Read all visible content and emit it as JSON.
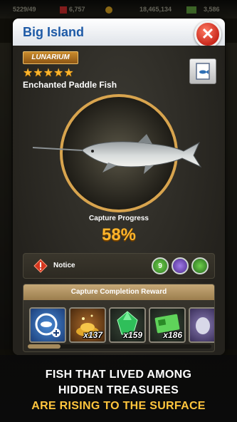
{
  "hud": {
    "stat1": "5229/49",
    "stat2": "6,757",
    "stat3": "18,465,134",
    "stat4": "3,586"
  },
  "panel": {
    "title": "Big Island",
    "close_icon": "close-x-icon",
    "rarity": "LUNARIUM",
    "stars": "★★★★★",
    "star_count": 5,
    "fish_name": "Enchanted Paddle Fish",
    "capture_label": "Capture Progress",
    "capture_value": "58%",
    "notice_label": "Notice",
    "baits": [
      {
        "label": "9",
        "color": "#4fa33a"
      },
      {
        "label": "",
        "color": "#7a4bc6"
      },
      {
        "label": "",
        "color": "#3f9c3a"
      }
    ],
    "reward_title": "Capture Completion Reward",
    "rewards": [
      {
        "icon": "fish-slot-plus-icon",
        "count": ""
      },
      {
        "icon": "gold-coin-pile-icon",
        "count": "x137"
      },
      {
        "icon": "green-gem-icon",
        "count": "x159"
      },
      {
        "icon": "green-ticket-icon",
        "count": "x186"
      },
      {
        "icon": "mystery-item-icon",
        "count": ""
      }
    ]
  },
  "promo": {
    "line1": "FISH THAT LIVED AMONG",
    "line2": "HIDDEN TREASURES",
    "line3": "ARE RISING TO THE SURFACE"
  },
  "colors": {
    "title_blue": "#1e5aa6",
    "accent_gold": "#ffb52b",
    "close_red": "#c8271b"
  }
}
